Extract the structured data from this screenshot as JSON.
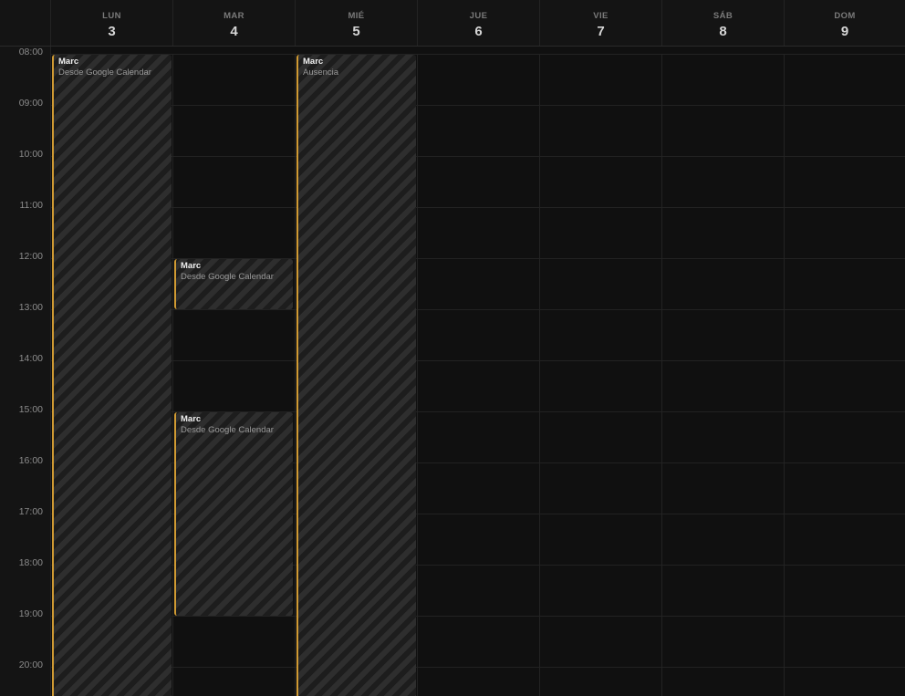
{
  "days": [
    {
      "name": "LUN",
      "num": "3"
    },
    {
      "name": "MAR",
      "num": "4"
    },
    {
      "name": "MIÉ",
      "num": "5"
    },
    {
      "name": "JUE",
      "num": "6"
    },
    {
      "name": "VIE",
      "num": "7"
    },
    {
      "name": "SÁB",
      "num": "8"
    },
    {
      "name": "DOM",
      "num": "9"
    }
  ],
  "times": [
    "08:00",
    "09:00",
    "10:00",
    "11:00",
    "12:00",
    "13:00",
    "14:00",
    "15:00",
    "16:00",
    "17:00",
    "18:00",
    "19:00",
    "20:00"
  ],
  "events": [
    {
      "title": "Marc",
      "subtitle": "Desde Google Calendar"
    },
    {
      "title": "Marc",
      "subtitle": "Desde Google Calendar"
    },
    {
      "title": "Marc",
      "subtitle": "Desde Google Calendar"
    },
    {
      "title": "Marc",
      "subtitle": "Ausencia"
    }
  ],
  "colors": {
    "accent": "#d09a33",
    "background": "#101010",
    "header": "#141414"
  }
}
